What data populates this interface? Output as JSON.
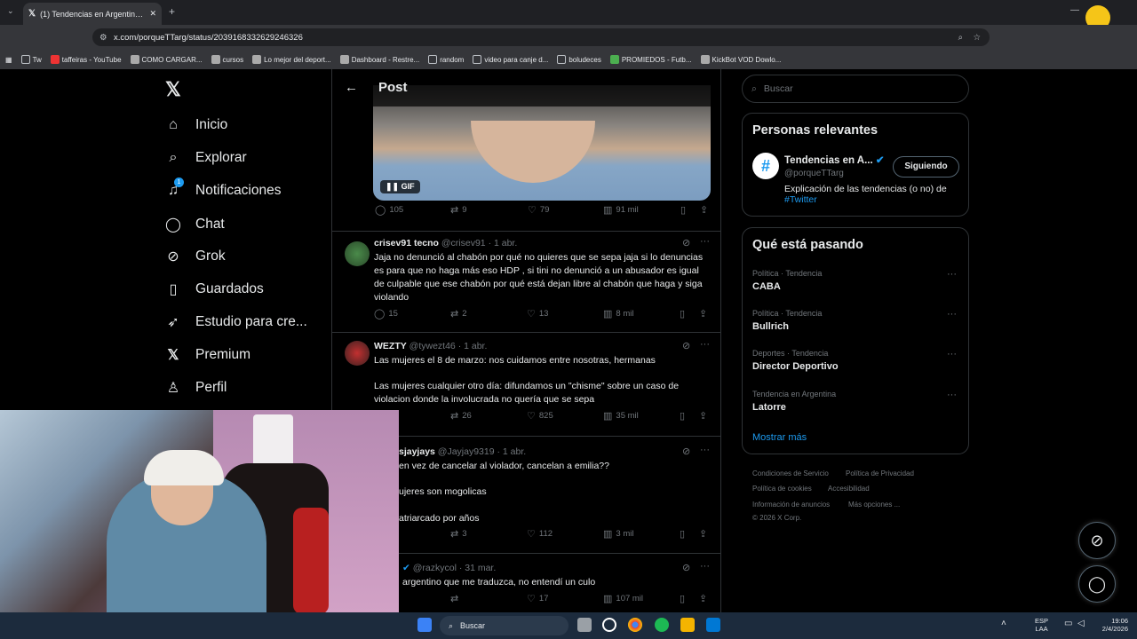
{
  "browser": {
    "tab_title": "(1) Tendencias en Argentina en",
    "url": "x.com/porqueTTarg/status/2039168332629246326",
    "bookmarks": [
      "Tw",
      "taffeiras - YouTube",
      "COMO CARGAR...",
      "cursos",
      "Lo mejor del deport...",
      "Dashboard - Restre...",
      "random",
      "video para canje d...",
      "boludeces",
      "PROMIEDOS - Futb...",
      "KickBot VOD Dowlo..."
    ]
  },
  "nav": {
    "items": [
      {
        "label": "Inicio",
        "icon": "home-icon"
      },
      {
        "label": "Explorar",
        "icon": "search-icon"
      },
      {
        "label": "Notificaciones",
        "icon": "bell-icon",
        "badge": "1"
      },
      {
        "label": "Chat",
        "icon": "chat-icon"
      },
      {
        "label": "Grok",
        "icon": "grok-icon"
      },
      {
        "label": "Guardados",
        "icon": "bookmark-icon"
      },
      {
        "label": "Estudio para cre...",
        "icon": "rocket-icon"
      },
      {
        "label": "Premium",
        "icon": "x-logo-icon"
      },
      {
        "label": "Perfil",
        "icon": "person-icon"
      }
    ]
  },
  "post": {
    "header_title": "Post",
    "gif_label": "GIF",
    "media_stats": {
      "replies": "105",
      "reposts": "9",
      "likes": "79",
      "views": "91 mil"
    }
  },
  "replies": [
    {
      "name": "crisev91 tecno",
      "handle": "@crisev91",
      "time": "· 1 abr.",
      "text": "Jaja no denunció al chabón por qué no quieres que se sepa jaja si lo denuncias es para que no haga más eso HDP , si tini no denunció a un abusador es igual de culpable que ese chabón por qué está dejan libre al chabón que haga y siga violando",
      "replies": "15",
      "reposts": "2",
      "likes": "13",
      "views": "8 mil"
    },
    {
      "name": "WEZTY",
      "handle": "@tywezt46",
      "time": "· 1 abr.",
      "text1": "Las mujeres el 8 de marzo: nos cuidamos entre nosotras, hermanas",
      "text2": "Las mujeres cualquier otro día: difundamos un \"chisme\" sobre un caso de violacion donde la involucrada no quería que se sepa",
      "replies": "",
      "reposts": "26",
      "likes": "825",
      "views": "35 mil"
    },
    {
      "name": "sjayjays",
      "handle": "@Jayjay9319",
      "time": "· 1 abr.",
      "text1": "en vez de cancelar al violador, cancelan a emilia??",
      "text2": "ujeres son mogolicas",
      "text3": "atriarcado por años",
      "reposts": "3",
      "likes": "112",
      "views": "3 mil"
    },
    {
      "name": "",
      "handle": "@razkycol",
      "time": "· 31 mar.",
      "text": "argentino que me traduzca, no entendí un culo",
      "likes": "17",
      "views": "107 mil"
    }
  ],
  "sidebar": {
    "search_placeholder": "Buscar",
    "relevant_title": "Personas relevantes",
    "relevant_name": "Tendencias en A...",
    "relevant_handle": "@porqueTTarg",
    "follow_label": "Siguiendo",
    "relevant_bio": "Explicación de las tendencias (o no) de",
    "relevant_bio_link": "#Twitter",
    "trends_title": "Qué está pasando",
    "trends": [
      {
        "meta": "Política · Tendencia",
        "name": "CABA"
      },
      {
        "meta": "Política · Tendencia",
        "name": "Bullrich"
      },
      {
        "meta": "Deportes · Tendencia",
        "name": "Director Deportivo"
      },
      {
        "meta": "Tendencia en Argentina",
        "name": "Latorre"
      }
    ],
    "show_more": "Mostrar más",
    "footer": [
      "Condiciones de Servicio",
      "Política de Privacidad",
      "Política de cookies",
      "Accesibilidad",
      "Información de anuncios",
      "Más opciones ...",
      "© 2026 X Corp."
    ]
  },
  "taskbar": {
    "search_placeholder": "Buscar",
    "lang1": "ESP",
    "lang2": "LAA",
    "time": "19:06",
    "date": "2/4/2026"
  },
  "colors": {
    "accent": "#1d9bf0",
    "background": "#000000",
    "border": "#2f3336",
    "muted": "#71767b"
  }
}
